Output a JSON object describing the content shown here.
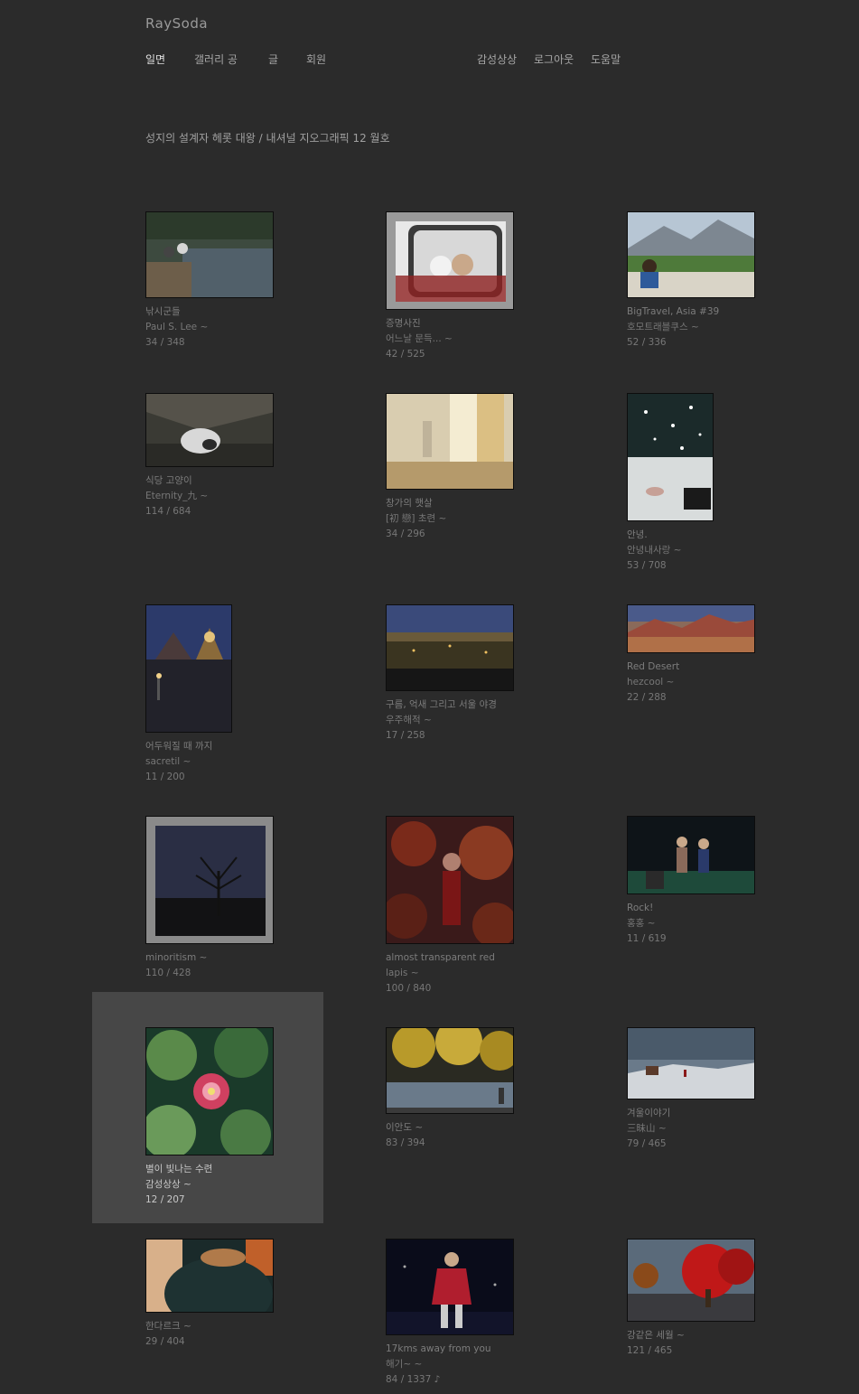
{
  "logo": "RaySoda",
  "nav": {
    "left": [
      {
        "label": "일면",
        "active": true
      },
      {
        "label": "갤러리 공",
        "active": false
      },
      {
        "label": "글",
        "active": false
      },
      {
        "label": "회원",
        "active": false
      }
    ],
    "right": [
      {
        "label": "감성상상"
      },
      {
        "label": "로그아웃"
      },
      {
        "label": "도움말"
      }
    ]
  },
  "headline": "성지의 설계자 헤롯 대왕 / 내셔널 지오그래픽 12 월호",
  "photos": [
    {
      "title": "낚시군들",
      "author": "Paul S. Lee ~",
      "stats": "34 / 348"
    },
    {
      "title": "증명사진",
      "author": "어느날 문득... ~",
      "stats": "42 / 525"
    },
    {
      "title": "BigTravel, Asia #39",
      "author": "호모트래블쿠스 ~",
      "stats": "52 / 336"
    },
    {
      "title": "식당 고양이",
      "author": "Eternity_九 ~",
      "stats": "114 / 684"
    },
    {
      "title": "창가의 햇살",
      "author": "[初 戀] 초련 ~",
      "stats": "34 / 296"
    },
    {
      "title": "안녕.",
      "author": "안녕내사랑 ~",
      "stats": "53 / 708"
    },
    {
      "title": "어두워질 때 까지",
      "author": "sacretil ~",
      "stats": "11 / 200"
    },
    {
      "title": "구름, 억새 그리고 서울 야경",
      "author": "우주해적 ~",
      "stats": "17 / 258"
    },
    {
      "title": "Red Desert",
      "author": "hezcool ~",
      "stats": "22 / 288"
    },
    {
      "title": "minoritism ~",
      "author": "110 / 428",
      "stats": ""
    },
    {
      "title": "almost transparent red",
      "author": "lapis ~",
      "stats": "100 / 840"
    },
    {
      "title": "Rock!",
      "author": "홍홍 ~",
      "stats": "11 / 619"
    },
    {
      "title": "별이 빛나는 수련",
      "author": "감성상상 ~",
      "stats": "12 / 207"
    },
    {
      "title": "이안도 ~",
      "author": "83 / 394",
      "stats": ""
    },
    {
      "title": "겨울이야기",
      "author": "三昧山 ~",
      "stats": "79 / 465"
    },
    {
      "title": "한다르크 ~",
      "author": "29 / 404",
      "stats": ""
    },
    {
      "title": "17kms away from you",
      "author": "해기~ ~",
      "stats": "84 / 1337 ♪"
    },
    {
      "title": "강같은 세월 ~",
      "author": "121 / 465",
      "stats": ""
    }
  ]
}
